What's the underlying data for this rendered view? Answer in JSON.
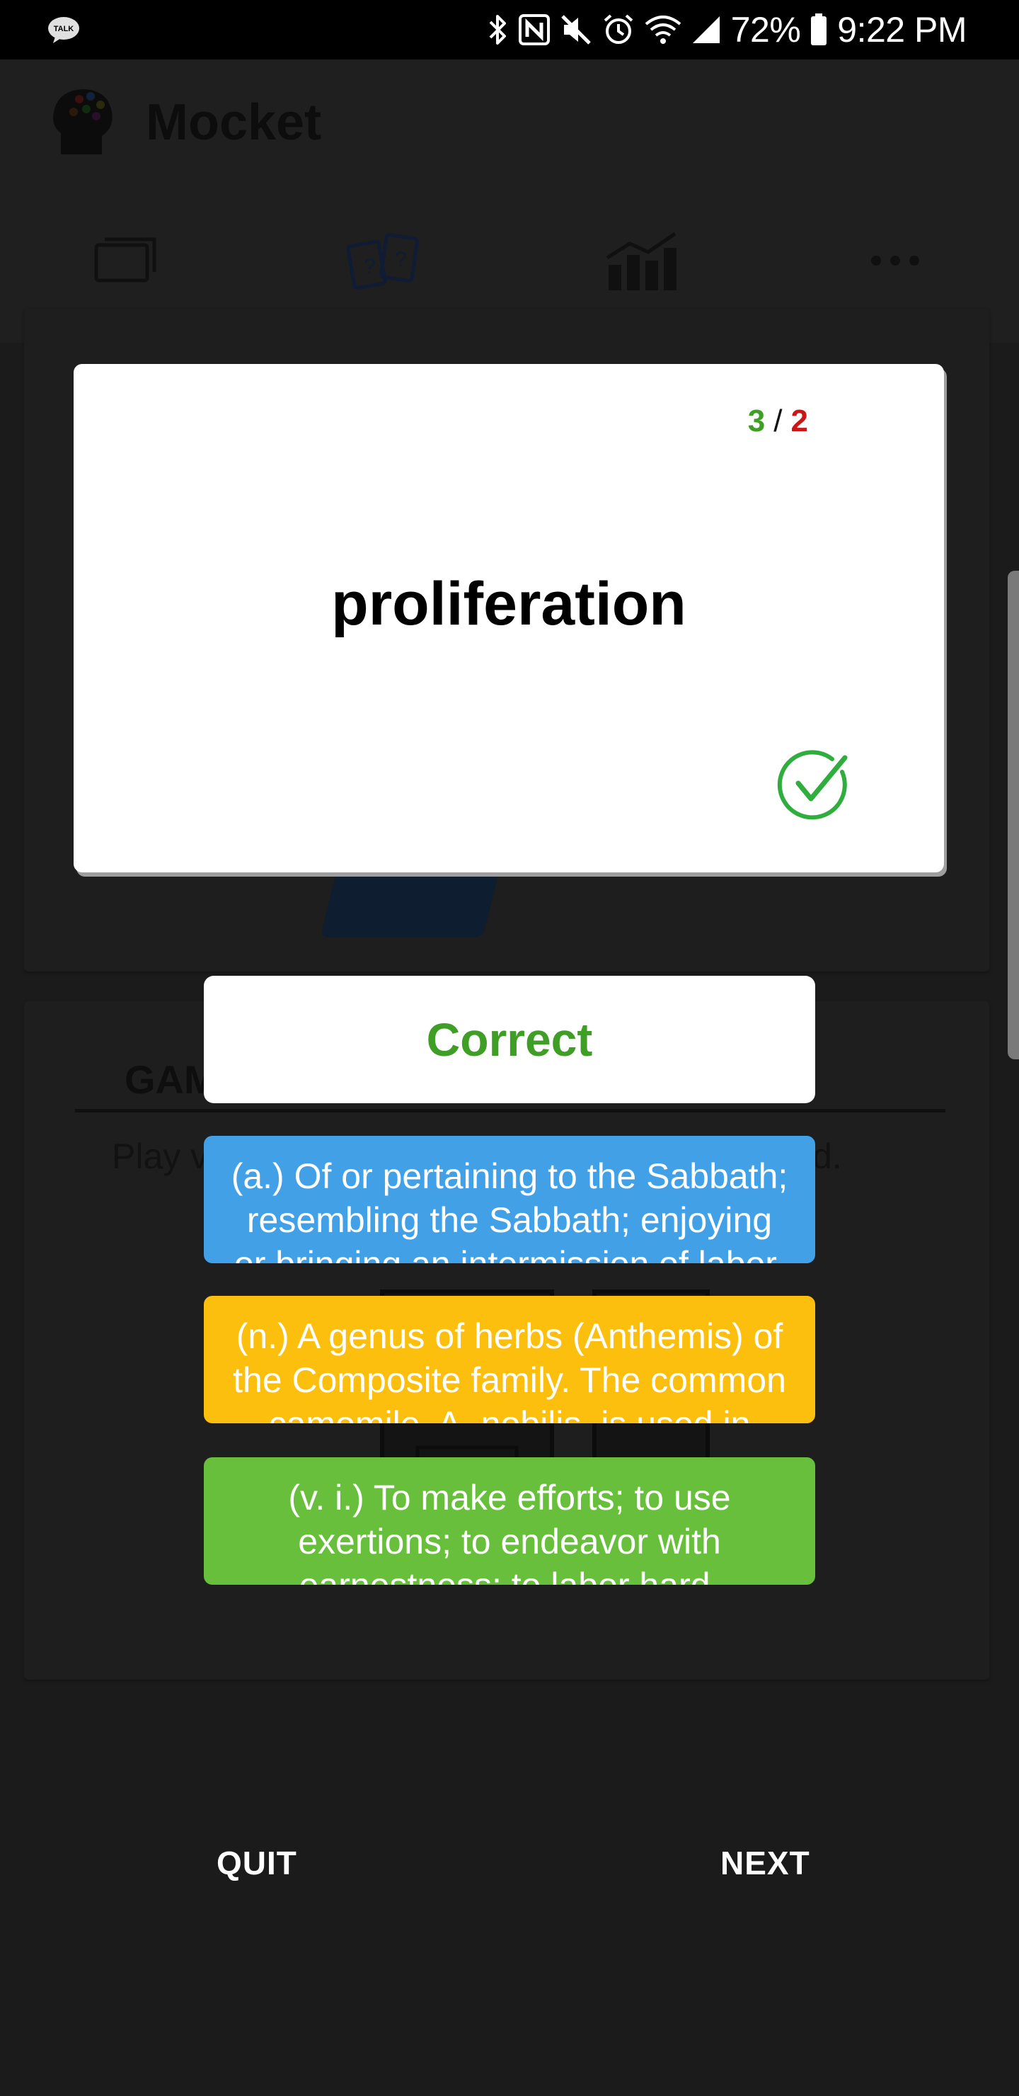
{
  "status_bar": {
    "battery": "72%",
    "time": "9:22 PM",
    "notification_icon": "kakaotalk-icon",
    "system_icons": [
      "bluetooth-icon",
      "nfc-icon",
      "mute-icon",
      "alarm-icon",
      "wifi-icon",
      "signal-icon",
      "battery-icon"
    ]
  },
  "app": {
    "title": "Mocket",
    "tabs": [
      {
        "icon": "cards-icon"
      },
      {
        "icon": "quiz-cards-icon",
        "selected": true
      },
      {
        "icon": "stats-icon"
      },
      {
        "icon": "more-icon"
      }
    ],
    "games_title": "GAMES",
    "games_desc_visible": "Play v",
    "games_desc_tail": "d."
  },
  "dialog": {
    "score_correct": "3",
    "score_separator": "/",
    "score_wrong": "2",
    "word": "proliferation",
    "result": "Correct",
    "options": [
      {
        "text": "(a.) Of or pertaining to the Sabbath; resembling the Sabbath; enjoying or bringing an intermission of labor.",
        "color": "#42a0e7"
      },
      {
        "text": "(n.) A genus of herbs (Anthemis) of the Composite family. The common camomile, A. nobilis, is used in medicine.",
        "color": "#fdbf0e"
      },
      {
        "text": "(v. i.) To make efforts; to use exertions; to endeavor with earnestness; to labor hard.",
        "color": "#68bf3b"
      }
    ],
    "quit_label": "QUIT",
    "next_label": "NEXT"
  },
  "colors": {
    "correct_green": "#3f9e25",
    "wrong_red": "#cc1515",
    "overlay_background": "#1b1b1b"
  }
}
